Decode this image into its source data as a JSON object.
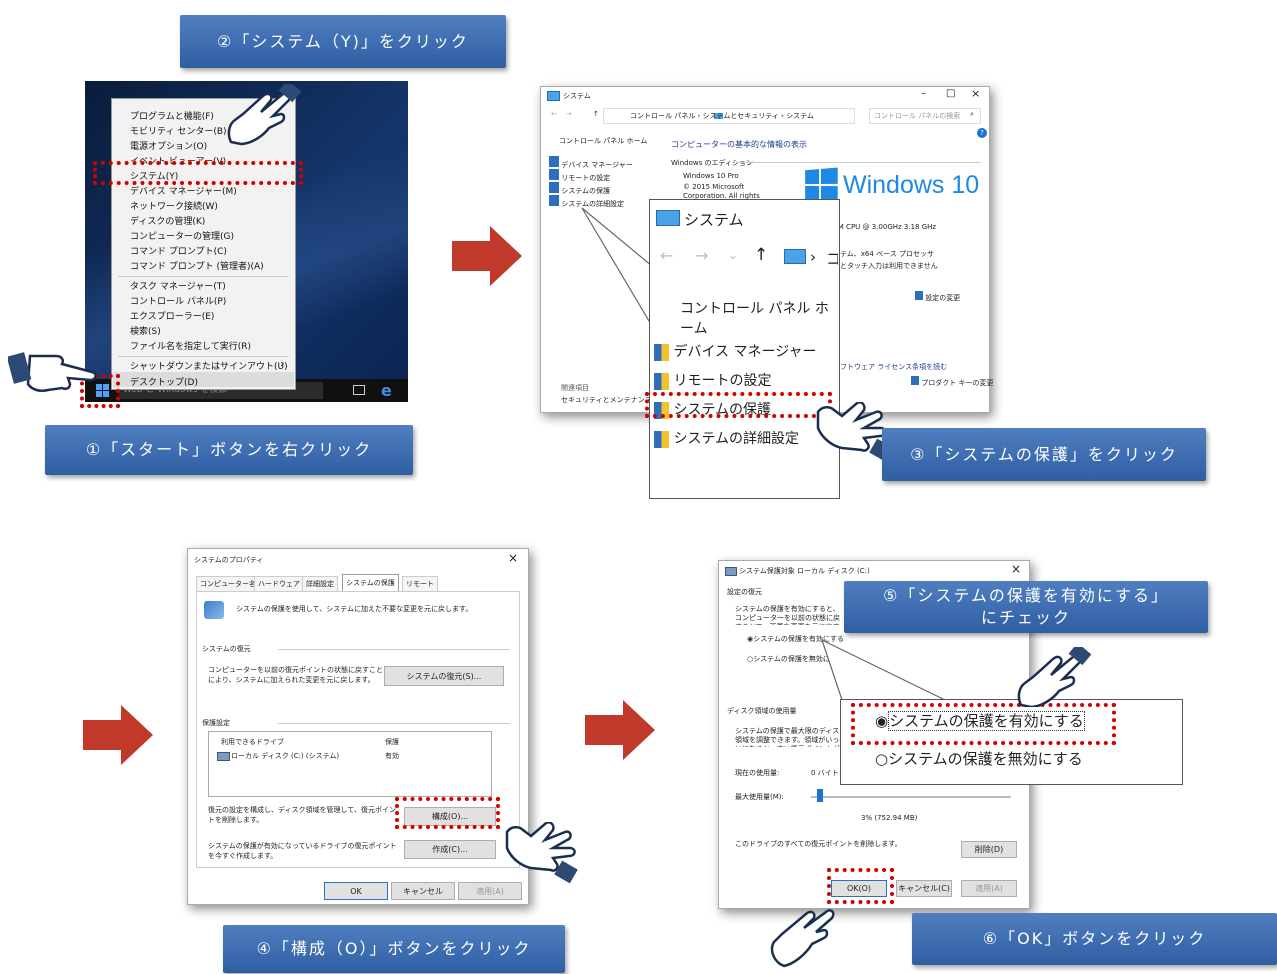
{
  "banners": {
    "step1": "①「スタート」ボタンを右クリック",
    "step2": "②「システム（Y)」をクリック",
    "step3": "③「システムの保護」をクリック",
    "step4": "④「構成（O）」ボタンをクリック",
    "step5_line1": "⑤「システムの保護を有効にする」",
    "step5_line2": "にチェック",
    "step6": "⑥「OK」ボタンをクリック"
  },
  "context_menu": {
    "items": [
      "プログラムと機能(F)",
      "モビリティ センター(B)",
      "電源オプション(O)",
      "イベント ビューアー(V)",
      "システム(Y)",
      "デバイス マネージャー(M)",
      "ネットワーク接続(W)",
      "ディスクの管理(K)",
      "コンピューターの管理(G)",
      "コマンド プロンプト(C)",
      "コマンド プロンプト (管理者)(A)",
      "タスク マネージャー(T)",
      "コントロール パネル(P)",
      "エクスプローラー(E)",
      "検索(S)",
      "ファイル名を指定して実行(R)",
      "シャットダウンまたはサインアウト(U)",
      "デスクトップ(D)"
    ],
    "taskbar_search": "Web と Windows を検索"
  },
  "system_window": {
    "title": "システム",
    "breadcrumb": "コントロール パネル › システムとセキュリティ › システム",
    "search_placeholder": "コントロール パネルの検索",
    "min": "–",
    "max": "□",
    "close": "×",
    "sidebar_home": "コントロール パネル ホーム",
    "sidebar_items": [
      "デバイス マネージャー",
      "リモートの設定",
      "システムの保護",
      "システムの詳細設定"
    ],
    "related_title": "関連項目",
    "related_item": "セキュリティとメンテナンス",
    "heading": "コンピューターの基本的な情報の表示",
    "edition_label": "Windows のエディション",
    "edition_name": "Windows 10 Pro",
    "copyright": "© 2015 Microsoft Corporation. All rights reserved.",
    "logo_text": "Windows 10",
    "cpu": "XM CPU @ 3.00GHz 3.18 GHz",
    "system_type": "ステム、x64 ベース プロセッサ",
    "pen": "力とタッチ入力は利用できません",
    "change_settings": "設定の変更",
    "license": "ソフトウェア ライセンス条項を読む",
    "product_key": "プロダクト キーの変更"
  },
  "zoom_callout": {
    "title": "システム",
    "home": "コントロール パネル ホーム",
    "items": [
      "デバイス マネージャー",
      "リモートの設定",
      "システムの保護",
      "システムの詳細設定"
    ]
  },
  "properties_dialog": {
    "title": "システムのプロパティ",
    "close": "×",
    "tabs": [
      "コンピューター名",
      "ハードウェア",
      "詳細設定",
      "システムの保護",
      "リモート"
    ],
    "intro": "システムの保護を使用して、システムに加えた不要な変更を元に戻します。",
    "restore_group": "システムの復元",
    "restore_desc": "コンピューターを以前の復元ポイントの状態に戻すことにより、システムに加えられた変更を元に戻します。",
    "restore_button": "システムの復元(S)...",
    "protection_group": "保護設定",
    "col_drive": "利用できるドライブ",
    "col_protect": "保護",
    "drive_name": "ローカル ディスク (C:) (システム)",
    "drive_state": "有効",
    "configure_desc": "復元の設定を構成し、ディスク領域を管理して、復元ポイントを削除します。",
    "configure_button": "構成(O)...",
    "create_desc": "システムの保護が有効になっているドライブの復元ポイントを今すぐ作成します。",
    "create_button": "作成(C)...",
    "ok": "OK",
    "cancel": "キャンセル",
    "apply": "適用(A)"
  },
  "protect_dialog": {
    "title": "システム保護対象 ローカル ディスク (C:)",
    "close": "×",
    "restore_settings": "設定の復元",
    "restore_desc": "システムの保護を有効にすると、コンピューターを以前の状態に戻すことで、不要な変更を元に戻すことができます。",
    "radio_on": "システムの保護を有効にする",
    "radio_off": "システムの保護を無効にする",
    "disk_group": "ディスク領域の使用量",
    "disk_desc": "システムの保護で最大限のディスク領域を調整できます。領域がいっぱいになると、古い復元ポイントが削除されます。",
    "current_label": "現在の使用量:",
    "current_value": "0 バイト",
    "max_label": "最大使用量(M):",
    "max_value": "3% (752.94 MB)",
    "max_fraction": 0.03,
    "delete_desc": "このドライブのすべての復元ポイントを削除します。",
    "delete_button": "削除(D)",
    "ok": "OK(O)",
    "cancel": "キャンセル(C)",
    "apply": "適用(A)"
  },
  "colors": {
    "banner": "#3b6db3",
    "highlight": "#d40000",
    "arrow": "#c0392b",
    "win10_blue": "#1e88e5"
  }
}
